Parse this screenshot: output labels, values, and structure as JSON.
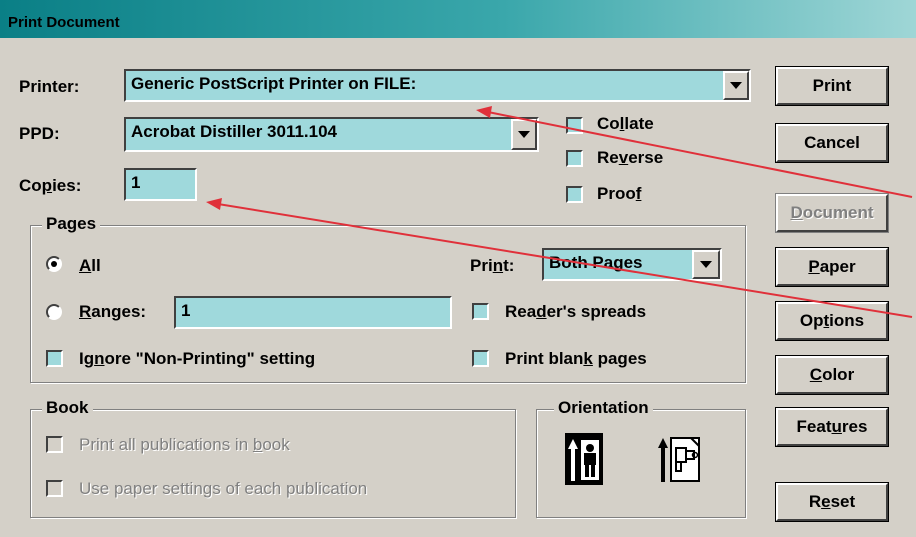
{
  "window": {
    "title": "Print Document"
  },
  "printer": {
    "label": "Printer:",
    "value": "Generic PostScript Printer on FILE:"
  },
  "ppd": {
    "label": "PPD:",
    "value": "Acrobat Distiller 3011.104"
  },
  "copies": {
    "label": "Copies:",
    "value": "1"
  },
  "options": {
    "collate": "Collate",
    "reverse": "Reverse",
    "proof": "Proof"
  },
  "pages": {
    "title": "Pages",
    "all": "All",
    "ranges_label": "Ranges:",
    "ranges_value": "1",
    "print_label": "Print:",
    "print_value": "Both Pages",
    "ignore_nonprinting": "Ignore \"Non-Printing\" setting",
    "readers_spreads": "Reader's spreads",
    "print_blank": "Print blank pages",
    "selected": "All"
  },
  "book": {
    "title": "Book",
    "print_all": "Print all publications in book",
    "use_paper": "Use paper settings of each publication"
  },
  "orientation": {
    "title": "Orientation",
    "selected": "portrait"
  },
  "buttons": {
    "print": "Print",
    "cancel": "Cancel",
    "document": "Document",
    "paper": "Paper",
    "options": "Options",
    "color": "Color",
    "features": "Features",
    "reset": "Reset"
  },
  "colors": {
    "field_bg": "#9fd9dc",
    "dialog_bg": "#d4d0c8",
    "title_bar": "#0a7f86",
    "annotation_arrow": "#e0303a"
  },
  "icons": [
    "dropdown-arrow-icon",
    "portrait-orientation-icon",
    "landscape-orientation-icon"
  ]
}
